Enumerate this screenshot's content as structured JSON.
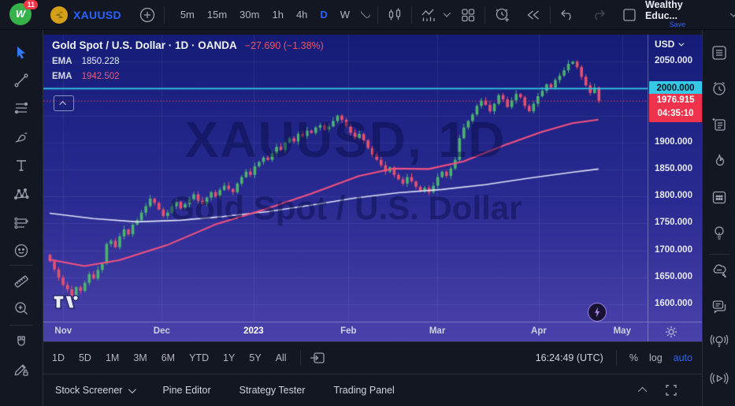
{
  "topbar": {
    "badge": "11",
    "logo_letter": "W",
    "symbol": "XAUUSD",
    "timeframes": [
      "5m",
      "15m",
      "30m",
      "1h",
      "4h",
      "D",
      "W"
    ],
    "active_timeframe": "D",
    "account": "Wealthy Educ...",
    "save": "Save"
  },
  "legend": {
    "title": "Gold Spot / U.S. Dollar · 1D · OANDA",
    "change": "−27.690 (−1.38%)",
    "ema1_label": "EMA",
    "ema1_value": "1850.228",
    "ema2_label": "EMA",
    "ema2_value": "1942.502"
  },
  "watermark": {
    "line1": "XAUUSD, 1D",
    "line2": "Gold Spot / U.S. Dollar"
  },
  "price_scale": {
    "currency": "USD",
    "hline_label": "2000.000",
    "last_price": "1976.915",
    "countdown": "04:35:10"
  },
  "range_bar": {
    "ranges": [
      "1D",
      "5D",
      "1M",
      "3M",
      "6M",
      "YTD",
      "1Y",
      "5Y",
      "All"
    ],
    "clock": "16:24:49 (UTC)",
    "percent": "%",
    "log": "log",
    "auto": "auto"
  },
  "bottom_panel": {
    "tabs": [
      "Stock Screener",
      "Pine Editor",
      "Strategy Tester",
      "Trading Panel"
    ]
  },
  "chart_data": {
    "type": "candlestick",
    "symbol": "XAUUSD",
    "interval": "1D",
    "exchange": "OANDA",
    "title": "Gold Spot / U.S. Dollar",
    "last_price": 1976.915,
    "change": -27.69,
    "change_pct": -1.38,
    "price_axis": {
      "currency": "USD",
      "ticks": [
        2050,
        2000,
        1950,
        1900,
        1850,
        1800,
        1750,
        1700,
        1650,
        1600
      ],
      "visible_range": [
        1568,
        2100
      ]
    },
    "time_axis": {
      "labels": [
        {
          "text": "Nov",
          "pos": 0.033
        },
        {
          "text": "Dec",
          "pos": 0.196
        },
        {
          "text": "2023",
          "pos": 0.348,
          "year": true
        },
        {
          "text": "Feb",
          "pos": 0.505
        },
        {
          "text": "Mar",
          "pos": 0.652
        },
        {
          "text": "Apr",
          "pos": 0.82
        },
        {
          "text": "May",
          "pos": 0.958
        }
      ]
    },
    "horizontal_line": {
      "price": 2000.0,
      "label": "2000.000",
      "color": "#35c9e6"
    },
    "current_price_line": {
      "price": 1976.915,
      "style": "dotted",
      "color": "#f23c55"
    },
    "emas": [
      {
        "label": "EMA",
        "value": 1850.228,
        "color": "#dfe3f5",
        "width": 1.6,
        "points": [
          [
            0,
            1769
          ],
          [
            10,
            1759
          ],
          [
            20,
            1753
          ],
          [
            30,
            1756
          ],
          [
            40,
            1763
          ],
          [
            50,
            1772
          ],
          [
            60,
            1784
          ],
          [
            70,
            1797
          ],
          [
            80,
            1807
          ],
          [
            90,
            1813
          ],
          [
            100,
            1822
          ],
          [
            110,
            1834
          ],
          [
            120,
            1845
          ],
          [
            126,
            1851
          ]
        ]
      },
      {
        "label": "EMA",
        "value": 1942.502,
        "color": "#f2517e",
        "width": 2.1,
        "points": [
          [
            0,
            1683
          ],
          [
            8,
            1671
          ],
          [
            16,
            1682
          ],
          [
            27,
            1710
          ],
          [
            38,
            1748
          ],
          [
            49,
            1775
          ],
          [
            60,
            1805
          ],
          [
            71,
            1838
          ],
          [
            79,
            1852
          ],
          [
            87,
            1851
          ],
          [
            95,
            1865
          ],
          [
            105,
            1897
          ],
          [
            113,
            1920
          ],
          [
            120,
            1936
          ],
          [
            126,
            1942.5
          ]
        ]
      }
    ],
    "candles": {
      "up_color": "#4bb470",
      "down_color": "#e8506e",
      "first_open": 1692,
      "closes": [
        1680,
        1665,
        1650,
        1636,
        1628,
        1616,
        1632,
        1625,
        1640,
        1656,
        1648,
        1664,
        1676,
        1712,
        1718,
        1706,
        1726,
        1739,
        1730,
        1748,
        1756,
        1770,
        1782,
        1796,
        1788,
        1776,
        1764,
        1770,
        1782,
        1790,
        1778,
        1786,
        1795,
        1804,
        1792,
        1786,
        1798,
        1808,
        1800,
        1812,
        1820,
        1814,
        1808,
        1824,
        1836,
        1846,
        1840,
        1856,
        1864,
        1872,
        1868,
        1880,
        1892,
        1886,
        1900,
        1908,
        1902,
        1916,
        1912,
        1922,
        1918,
        1928,
        1932,
        1924,
        1930,
        1940,
        1950,
        1942,
        1930,
        1918,
        1908,
        1916,
        1904,
        1890,
        1878,
        1868,
        1858,
        1846,
        1854,
        1840,
        1832,
        1824,
        1836,
        1828,
        1818,
        1810,
        1816,
        1808,
        1820,
        1836,
        1846,
        1838,
        1852,
        1868,
        1908,
        1928,
        1940,
        1952,
        1968,
        1978,
        1970,
        1958,
        1972,
        1988,
        1980,
        1966,
        1978,
        1990,
        1984,
        1968,
        1958,
        1972,
        1986,
        1996,
        2008,
        2002,
        2016,
        2024,
        2034,
        2046,
        2050,
        2040,
        2022,
        2006,
        1992,
        2002,
        1977
      ]
    },
    "grid": true,
    "legend_position": "top-left"
  },
  "colors": {
    "accent_blue": "#2962ff",
    "panel_bg": "#131722",
    "chart_bg_top": "#141c77",
    "chart_bg_bottom": "#4a42ab",
    "up": "#4bb470",
    "down": "#e8506e",
    "hline_label_bg": "#35c9e6",
    "price_label_bg": "#f0334c"
  }
}
